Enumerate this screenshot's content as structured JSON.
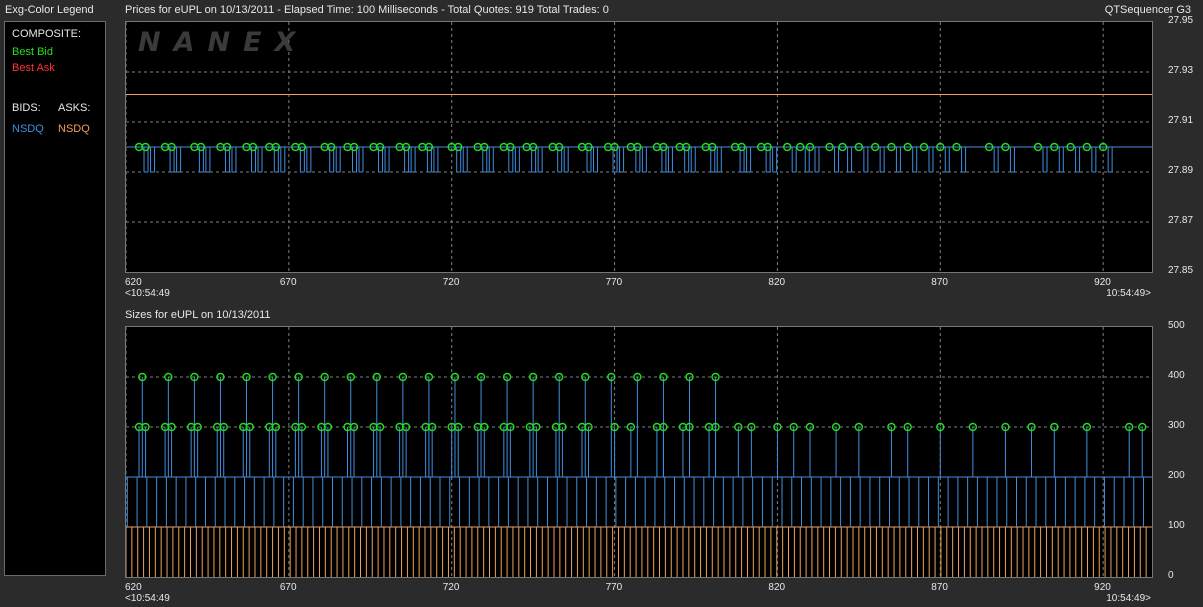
{
  "legend": {
    "title": "Exg-Color Legend",
    "composite_label": "COMPOSITE:",
    "best_bid": "Best Bid",
    "best_ask": "Best Ask",
    "bids_label": "BIDS:",
    "asks_label": "ASKS:",
    "bid_exchange": "NSDQ",
    "ask_exchange": "NSDQ"
  },
  "header": {
    "prices_title": "Prices for  eUPL  on  10/13/2011  -  Elapsed Time: 100 Milliseconds  -  Total Quotes: 919  Total Trades: 0",
    "app_name": "QTSequencer G3",
    "sizes_title": "Sizes for  eUPL  on 10/13/2011"
  },
  "watermark": "NANEX",
  "colors": {
    "bid": "#3f8fe0",
    "ask": "#f0a058",
    "best_bid_marker": "#22dd22",
    "best_bid_text": "#22dd22",
    "best_ask_text": "#ff3333",
    "grid": "#808080"
  },
  "chart_data": [
    {
      "type": "line",
      "title": "Prices for  eUPL  on  10/13/2011",
      "x_ticks": [
        "620",
        "670",
        "720",
        "770",
        "820",
        "870",
        "920"
      ],
      "x_start_label": "<10:54:49",
      "x_end_label": "10:54:49>",
      "xlim": [
        620,
        935
      ],
      "y_ticks": [
        "27.95",
        "27.93",
        "27.91",
        "27.89",
        "27.87",
        "27.85"
      ],
      "ylim": [
        27.85,
        27.95
      ],
      "grid": true,
      "series": [
        {
          "name": "NSDQ",
          "side": "ask",
          "constant": 27.921
        },
        {
          "name": "NSDQ",
          "side": "bid",
          "constant": 27.9,
          "dip_to": 27.89,
          "best_bid_markers": [
            624,
            626,
            632,
            634,
            641,
            643,
            649,
            651,
            657,
            659,
            664,
            666,
            672,
            674,
            681,
            683,
            688,
            690,
            696,
            698,
            704,
            706,
            711,
            713,
            720,
            722,
            728,
            730,
            736,
            738,
            743,
            745,
            751,
            753,
            760,
            762,
            768,
            770,
            775,
            777,
            783,
            785,
            790,
            792,
            798,
            800,
            807,
            809,
            815,
            817,
            823,
            827,
            830,
            836,
            840,
            845,
            850,
            855,
            860,
            865,
            870,
            875,
            885,
            890,
            900,
            905,
            910,
            915,
            920
          ]
        }
      ]
    },
    {
      "type": "bar",
      "title": "Sizes for  eUPL  on 10/13/2011",
      "x_ticks": [
        "620",
        "670",
        "720",
        "770",
        "820",
        "870",
        "920"
      ],
      "x_start_label": "<10:54:49",
      "x_end_label": "10:54:49>",
      "xlim": [
        620,
        935
      ],
      "y_ticks": [
        "500",
        "400",
        "300",
        "200",
        "100",
        "0"
      ],
      "ylim": [
        0,
        500
      ],
      "grid": true,
      "series": [
        {
          "name": "NSDQ",
          "side": "ask",
          "value": 100
        },
        {
          "name": "NSDQ",
          "side": "bid",
          "value": 200,
          "best_bid_sizes_400": [
            625,
            633,
            641,
            649,
            657,
            665,
            673,
            681,
            689,
            697,
            705,
            713,
            721,
            729,
            737,
            745,
            753,
            761,
            769,
            777,
            785,
            793,
            801
          ],
          "best_bid_sizes_300": [
            624,
            626,
            632,
            634,
            640,
            642,
            648,
            650,
            656,
            658,
            664,
            666,
            672,
            674,
            680,
            682,
            688,
            690,
            696,
            698,
            704,
            706,
            712,
            714,
            720,
            722,
            728,
            730,
            736,
            738,
            744,
            746,
            752,
            754,
            760,
            762,
            770,
            775,
            783,
            785,
            791,
            793,
            799,
            801,
            808,
            812,
            820,
            825,
            830,
            838,
            845,
            855,
            860,
            870,
            880,
            890,
            898,
            905,
            915,
            928,
            932
          ]
        }
      ]
    }
  ]
}
